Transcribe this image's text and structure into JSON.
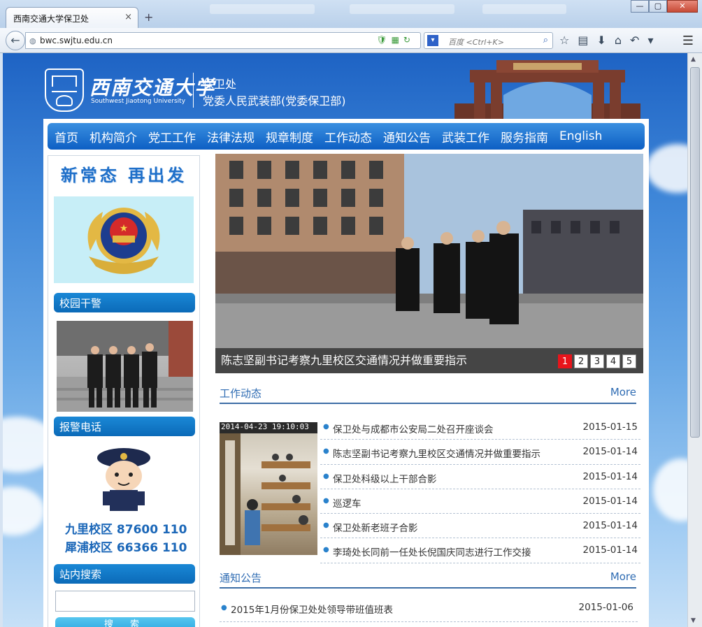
{
  "browser": {
    "tab_title": "西南交通大学保卫处",
    "tab_close": "×",
    "new_tab": "+",
    "url": "bwc.swjtu.edu.cn",
    "search_placeholder": "百度 <Ctrl+K>",
    "window_buttons": [
      "—",
      "▢",
      "✕"
    ]
  },
  "header": {
    "university_name": "西南交通大学",
    "university_en": "Southwest Jiaotong University",
    "dept_line1": "保卫处",
    "dept_line2": "党委人民武装部(党委保卫部)"
  },
  "nav": [
    "首页",
    "机构简介",
    "党工工作",
    "法律法规",
    "规章制度",
    "工作动态",
    "通知公告",
    "武装工作",
    "服务指南",
    "English"
  ],
  "sidebar": {
    "banner": "新常态 再出发",
    "section_police": "校园干警",
    "section_phone": "报警电话",
    "phone_lines": [
      "九里校区 87600 110",
      "犀浦校区 66366 110"
    ],
    "section_search": "站内搜索",
    "search_button": "搜 索"
  },
  "slideshow": {
    "caption": "陈志坚副书记考察九里校区交通情况并做重要指示",
    "pages": [
      "1",
      "2",
      "3",
      "4",
      "5"
    ],
    "active_page": 1
  },
  "work_news": {
    "title": "工作动态",
    "more": "More",
    "photo_timestamp": "2014-04-23 19:10:03",
    "items": [
      {
        "title": "保卫处与成都市公安局二处召开座谈会",
        "date": "2015-01-15"
      },
      {
        "title": "陈志坚副书记考察九里校区交通情况并做重要指示",
        "date": "2015-01-14"
      },
      {
        "title": "保卫处科级以上干部合影",
        "date": "2015-01-14"
      },
      {
        "title": "巡逻车",
        "date": "2015-01-14"
      },
      {
        "title": "保卫处新老班子合影",
        "date": "2015-01-14"
      },
      {
        "title": "李琦处长同前一任处长倪国庆同志进行工作交接",
        "date": "2015-01-14"
      }
    ]
  },
  "notices": {
    "title": "通知公告",
    "more": "More",
    "items": [
      {
        "title": "2015年1月份保卫处处领导带班值班表",
        "date": "2015-01-06"
      }
    ]
  }
}
